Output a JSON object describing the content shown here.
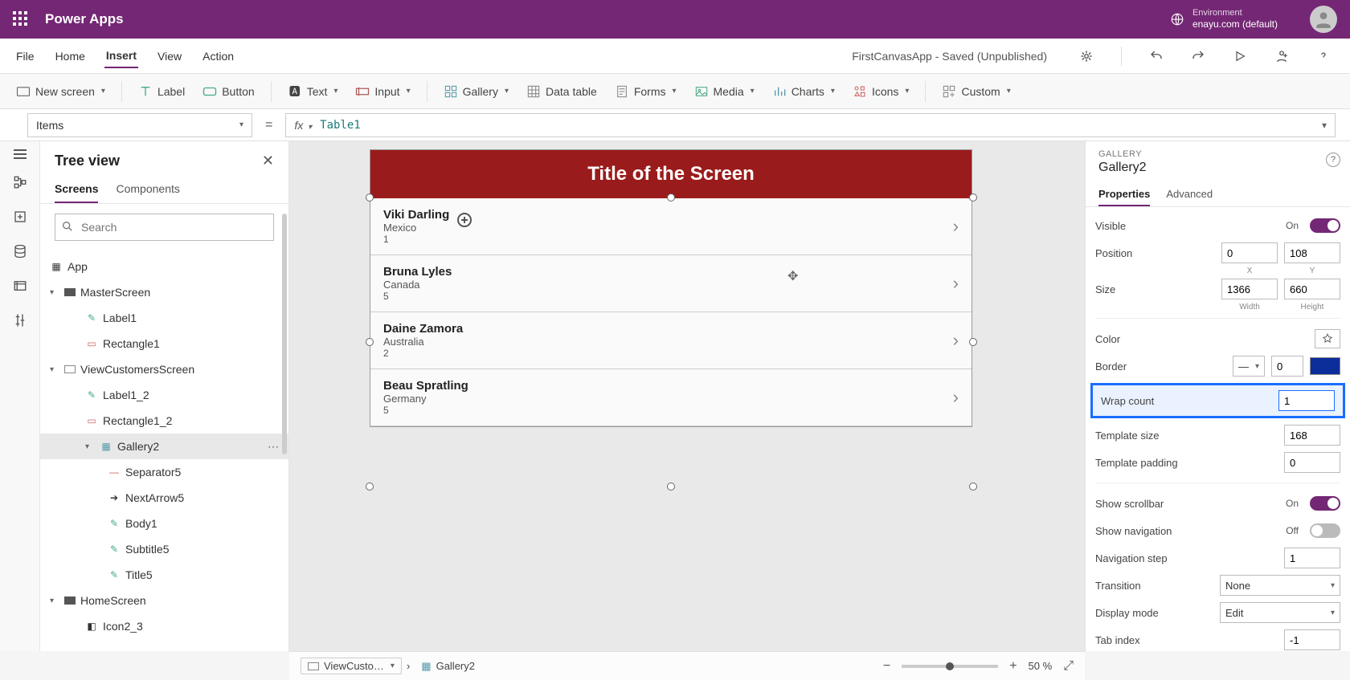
{
  "brand": "Power Apps",
  "environment": {
    "label": "Environment",
    "value": "enayu.com (default)"
  },
  "menubar": {
    "items": [
      "File",
      "Home",
      "Insert",
      "View",
      "Action"
    ],
    "active_index": 2,
    "app_status": "FirstCanvasApp - Saved (Unpublished)"
  },
  "ribbon": {
    "new_screen": "New screen",
    "label_btn": "Label",
    "button_btn": "Button",
    "text": "Text",
    "input": "Input",
    "gallery": "Gallery",
    "data_table": "Data table",
    "forms": "Forms",
    "media": "Media",
    "charts": "Charts",
    "icons": "Icons",
    "custom": "Custom"
  },
  "formula": {
    "property": "Items",
    "value": "Table1"
  },
  "tree": {
    "title": "Tree view",
    "tabs": [
      "Screens",
      "Components"
    ],
    "active_tab": 0,
    "search_placeholder": "Search",
    "app_node": "App",
    "nodes": {
      "master": "MasterScreen",
      "label1": "Label1",
      "rect1": "Rectangle1",
      "view": "ViewCustomersScreen",
      "label1_2": "Label1_2",
      "rect1_2": "Rectangle1_2",
      "gallery2": "Gallery2",
      "sep5": "Separator5",
      "nextarrow5": "NextArrow5",
      "body1": "Body1",
      "subtitle5": "Subtitle5",
      "title5": "Title5",
      "home": "HomeScreen",
      "icon2_3": "Icon2_3"
    }
  },
  "canvas": {
    "screen_title": "Title of the Screen",
    "rows": [
      {
        "name": "Viki  Darling",
        "country": "Mexico",
        "num": "1"
      },
      {
        "name": "Bruna  Lyles",
        "country": "Canada",
        "num": "5"
      },
      {
        "name": "Daine  Zamora",
        "country": "Australia",
        "num": "2"
      },
      {
        "name": "Beau  Spratling",
        "country": "Germany",
        "num": "5"
      }
    ]
  },
  "breadcrumb": {
    "screen": "ViewCusto…",
    "selected": "Gallery2",
    "zoom": "50"
  },
  "properties": {
    "category": "GALLERY",
    "name": "Gallery2",
    "tabs": [
      "Properties",
      "Advanced"
    ],
    "active_tab": 0,
    "visible_label": "Visible",
    "visible_state": "On",
    "position_label": "Position",
    "pos_x": "0",
    "pos_y": "108",
    "x_lbl": "X",
    "y_lbl": "Y",
    "size_label": "Size",
    "w": "1366",
    "h": "660",
    "w_lbl": "Width",
    "h_lbl": "Height",
    "color_label": "Color",
    "border_label": "Border",
    "border_val": "0",
    "border_color": "#0b2e9b",
    "wrap_label": "Wrap count",
    "wrap_val": "1",
    "tmpl_size_label": "Template size",
    "tmpl_size": "168",
    "tmpl_pad_label": "Template padding",
    "tmpl_pad": "0",
    "scroll_label": "Show scrollbar",
    "scroll_state": "On",
    "nav_label": "Show navigation",
    "nav_state": "Off",
    "nav_step_label": "Navigation step",
    "nav_step": "1",
    "transition_label": "Transition",
    "transition": "None",
    "display_mode_label": "Display mode",
    "display_mode": "Edit",
    "tab_index_label": "Tab index",
    "tab_index": "-1"
  }
}
